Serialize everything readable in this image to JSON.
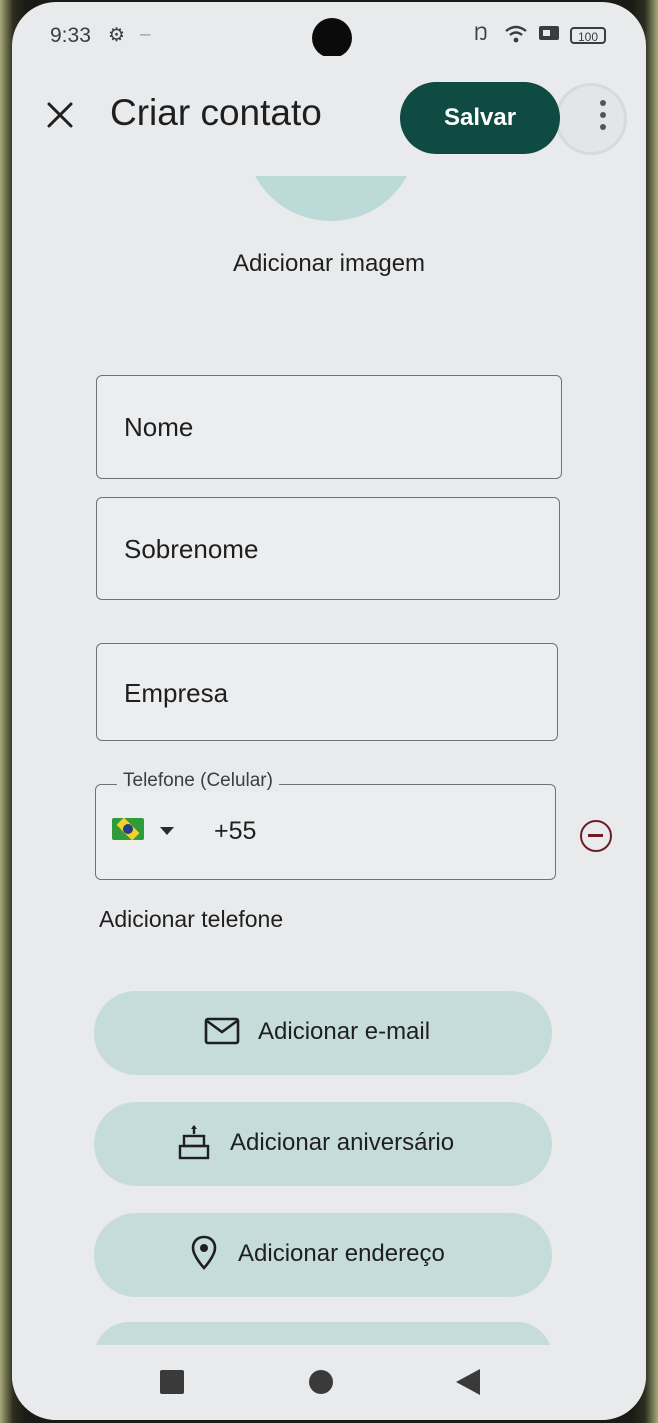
{
  "status_bar": {
    "time": "9:33",
    "battery": "100"
  },
  "app_bar": {
    "title": "Criar contato",
    "save_label": "Salvar"
  },
  "avatar": {
    "add_image_label": "Adicionar imagem"
  },
  "form": {
    "first_name_placeholder": "Nome",
    "last_name_placeholder": "Sobrenome",
    "company_placeholder": "Empresa",
    "phone": {
      "label": "Telefone (Celular)",
      "country_code": "+55",
      "country": "Brazil"
    },
    "add_phone_label": "Adicionar telefone"
  },
  "actions": {
    "add_email": "Adicionar e-mail",
    "add_birthday": "Adicionar aniversário",
    "add_address": "Adicionar endereço"
  },
  "colors": {
    "save_bg": "#0f4a43",
    "pill_bg": "#c5dcdb",
    "avatar_bg": "#bcdad7",
    "remove_icon": "#701d22"
  },
  "icons": [
    "close-icon",
    "more-vert-icon",
    "brazil-flag-icon",
    "dropdown-caret-icon",
    "remove-circle-icon",
    "mail-icon",
    "cake-icon",
    "location-pin-icon"
  ]
}
